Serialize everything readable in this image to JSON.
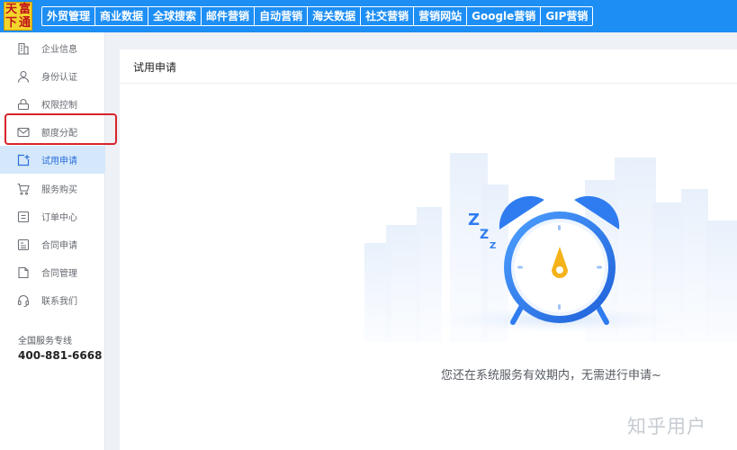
{
  "logo": {
    "chars": [
      "天",
      "富",
      "下",
      "通"
    ]
  },
  "nav": {
    "items": [
      "外贸管理",
      "商业数据",
      "全球搜索",
      "邮件营销",
      "自动营销",
      "海关数据",
      "社交营销",
      "营销网站",
      "Google营销",
      "GIP营销"
    ]
  },
  "sidebar": {
    "items": [
      {
        "label": "企业信息",
        "icon": "building-icon"
      },
      {
        "label": "身份认证",
        "icon": "user-icon"
      },
      {
        "label": "权限控制",
        "icon": "lock-icon"
      },
      {
        "label": "额度分配",
        "icon": "mail-icon"
      },
      {
        "label": "试用申请",
        "icon": "trial-add-icon",
        "active": true
      },
      {
        "label": "服务购买",
        "icon": "cart-icon"
      },
      {
        "label": "订单中心",
        "icon": "order-icon"
      },
      {
        "label": "合同申请",
        "icon": "contract-apply-icon"
      },
      {
        "label": "合同管理",
        "icon": "contract-icon"
      },
      {
        "label": "联系我们",
        "icon": "headset-icon"
      }
    ],
    "service_label": "全国服务专线",
    "phone": "400-881-6668"
  },
  "main": {
    "title": "试用申请",
    "empty_message": "您还在系统服务有效期内，无需进行申请~",
    "sleep_glyphs": [
      "Z",
      "Z",
      "Z"
    ]
  },
  "watermark": "知乎用户",
  "colors": {
    "topbar": "#1d8ef4",
    "accent": "#2b6fd8",
    "highlight_box": "#d8242a",
    "clock_blue": "#2f7cf0",
    "clock_center": "#f5b21b"
  }
}
